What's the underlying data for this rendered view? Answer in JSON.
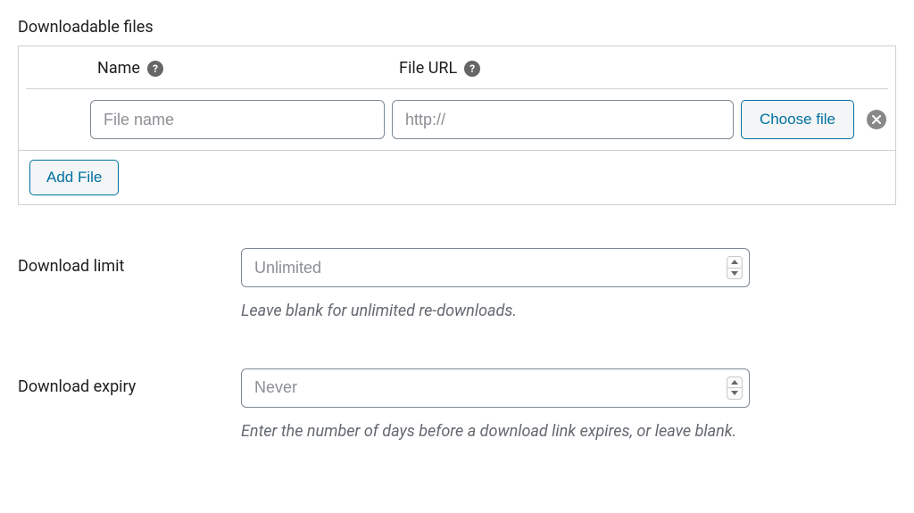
{
  "section": {
    "title": "Downloadable files",
    "columns": {
      "name": "Name",
      "url": "File URL"
    },
    "row": {
      "name_placeholder": "File name",
      "url_placeholder": "http://",
      "choose_file_label": "Choose file"
    },
    "add_file_label": "Add File"
  },
  "download_limit": {
    "label": "Download limit",
    "placeholder": "Unlimited",
    "help": "Leave blank for unlimited re-downloads."
  },
  "download_expiry": {
    "label": "Download expiry",
    "placeholder": "Never",
    "help": "Enter the number of days before a download link expires, or leave blank."
  }
}
